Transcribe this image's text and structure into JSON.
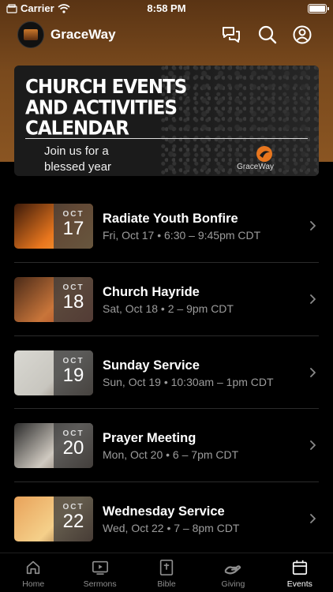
{
  "status_bar": {
    "carrier": "Carrier",
    "time": "8:58 PM"
  },
  "header": {
    "app_name": "GraceWay"
  },
  "banner": {
    "title": "CHURCH EVENTS AND ACTIVITIES CALENDAR",
    "subtitle_line1": "Join us for a",
    "subtitle_line2": "blessed year",
    "brand": "GraceWay"
  },
  "events": [
    {
      "month": "OCT",
      "day": "17",
      "title": "Radiate Youth Bonfire",
      "subtitle": "Fri, Oct 17 • 6:30 – 9:45pm CDT",
      "thumb_colors": [
        "#3b1a0a",
        "#e8761e",
        "#ffb347"
      ]
    },
    {
      "month": "OCT",
      "day": "18",
      "title": "Church Hayride",
      "subtitle": "Sat, Oct 18 • 2 – 9pm CDT",
      "thumb_colors": [
        "#4a2a18",
        "#c8753a",
        "#a13a1e"
      ]
    },
    {
      "month": "OCT",
      "day": "19",
      "title": "Sunday Service",
      "subtitle": "Sun, Oct 19 • 10:30am – 1pm CDT",
      "thumb_colors": [
        "#d9d8d2",
        "#c8c6bf",
        "#6b5a4a"
      ]
    },
    {
      "month": "OCT",
      "day": "20",
      "title": "Prayer Meeting",
      "subtitle": "Mon, Oct 20 • 6 – 7pm CDT",
      "thumb_colors": [
        "#2a2a2a",
        "#cfc9c0",
        "#5a4638"
      ]
    },
    {
      "month": "OCT",
      "day": "22",
      "title": "Wednesday Service",
      "subtitle": "Wed, Oct 22 • 7 – 8pm CDT",
      "thumb_colors": [
        "#e8a25a",
        "#f5d08a",
        "#6a3a1e"
      ]
    }
  ],
  "tabs": [
    {
      "label": "Home",
      "icon": "home-icon",
      "active": false
    },
    {
      "label": "Sermons",
      "icon": "play-video-icon",
      "active": false
    },
    {
      "label": "Bible",
      "icon": "bible-icon",
      "active": false
    },
    {
      "label": "Giving",
      "icon": "giving-hand-icon",
      "active": false
    },
    {
      "label": "Events",
      "icon": "calendar-icon",
      "active": true
    }
  ]
}
